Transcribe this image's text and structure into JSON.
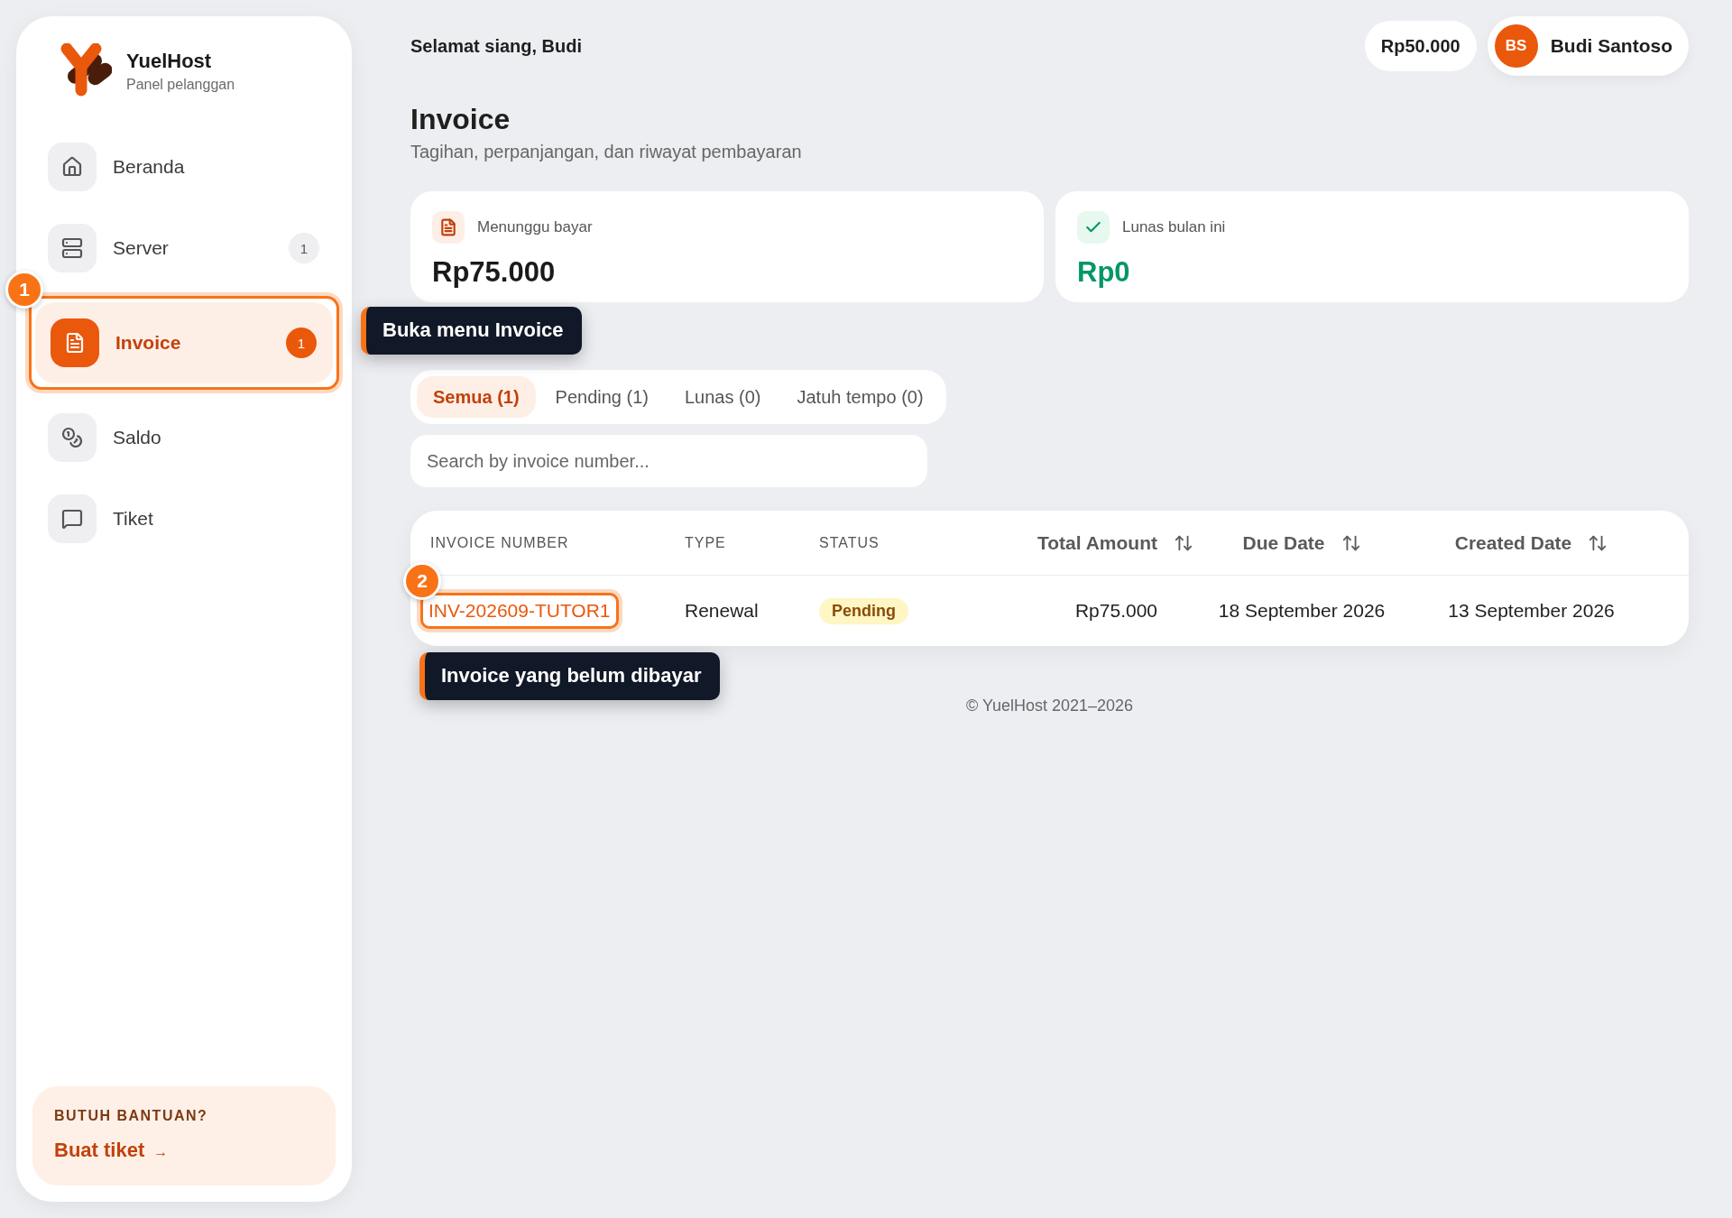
{
  "brand": {
    "name": "YuelHost",
    "subtitle": "Panel pelanggan"
  },
  "sidebar": {
    "items": [
      {
        "label": "Beranda",
        "kind": "home",
        "selected": false
      },
      {
        "label": "Server",
        "kind": "server",
        "count": "1",
        "selected": false
      },
      {
        "label": "Invoice",
        "kind": "invoice",
        "count": "1",
        "selected": true
      },
      {
        "label": "Saldo",
        "kind": "coins",
        "selected": false
      },
      {
        "label": "Tiket",
        "kind": "chat",
        "selected": false
      }
    ],
    "help": {
      "title": "BUTUH BANTUAN?",
      "link": "Buat tiket",
      "arrow": "→"
    }
  },
  "header": {
    "greeting": "Selamat siang, Budi",
    "balance": "Rp50.000",
    "user": {
      "initials": "BS",
      "name": "Budi Santoso"
    }
  },
  "page": {
    "title": "Invoice",
    "subtitle": "Tagihan, perpanjangan, dan riwayat pembayaran"
  },
  "stats": [
    {
      "kind": "pending",
      "label": "Menunggu bayar",
      "value": "Rp75.000"
    },
    {
      "kind": "paid",
      "label": "Lunas bulan ini",
      "value": "Rp0"
    }
  ],
  "tabs": [
    {
      "label": "Semua (1)",
      "selected": true
    },
    {
      "label": "Pending (1)",
      "selected": false
    },
    {
      "label": "Lunas (0)",
      "selected": false
    },
    {
      "label": "Jatuh tempo (0)",
      "selected": false
    }
  ],
  "search": {
    "placeholder": "Search by invoice number..."
  },
  "table": {
    "columns": [
      {
        "label": "INVOICE NUMBER",
        "kind": "plain"
      },
      {
        "label": "TYPE",
        "kind": "plain"
      },
      {
        "label": "STATUS",
        "kind": "plain"
      },
      {
        "label": "Total Amount",
        "kind": "sortable"
      },
      {
        "label": "Due Date",
        "kind": "sortable"
      },
      {
        "label": "Created Date",
        "kind": "sortable"
      }
    ],
    "rows": [
      {
        "invoice_number": "INV-202609-TUTOR1",
        "type": "Renewal",
        "status": {
          "label": "Pending",
          "kind": "pending"
        },
        "total_amount": "Rp75.000",
        "due_date": "18 September 2026",
        "created_date": "13 September 2026"
      }
    ]
  },
  "footer": "© YuelHost 2021–2026",
  "tour": {
    "steps": [
      {
        "number": "1",
        "tooltip": "Buka menu Invoice"
      },
      {
        "number": "2",
        "tooltip": "Invoice yang belum dibayar"
      }
    ]
  }
}
